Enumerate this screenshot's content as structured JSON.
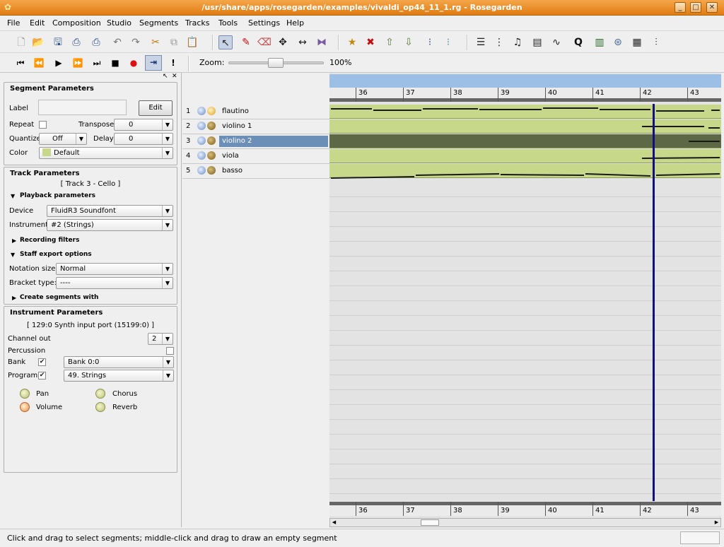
{
  "window": {
    "title": "/usr/share/apps/rosegarden/examples/vivaldi_op44_11_1.rg - Rosegarden"
  },
  "menu": [
    "File",
    "Edit",
    "Composition",
    "Studio",
    "Segments",
    "Tracks",
    "Tools",
    "Settings",
    "Help"
  ],
  "zoom": {
    "label": "Zoom:",
    "value": "100%",
    "level_percent": 100
  },
  "segment_params": {
    "title": "Segment Parameters",
    "label_label": "Label",
    "edit_button": "Edit",
    "repeat_label": "Repeat",
    "transpose_label": "Transpose",
    "transpose_value": "0",
    "quantize_label": "Quantize",
    "quantize_value": "Off",
    "delay_label": "Delay",
    "delay_value": "0",
    "color_label": "Color",
    "color_value": "Default"
  },
  "track_params": {
    "title": "Track Parameters",
    "track_info": "[ Track 3 - Cello ]",
    "playback_header": "Playback parameters",
    "device_label": "Device",
    "device_value": "FluidR3 Soundfont",
    "instrument_label": "Instrument",
    "instrument_value": "#2 (Strings)",
    "recording_header": "Recording filters",
    "staff_header": "Staff export options",
    "notation_label": "Notation size:",
    "notation_value": "Normal",
    "bracket_label": "Bracket type:",
    "bracket_value": "----",
    "create_header": "Create segments with"
  },
  "instrument_params": {
    "title": "Instrument Parameters",
    "port_info": "[ 129:0 Synth input port (15199:0) ]",
    "channel_label": "Channel out",
    "channel_value": "2",
    "percussion_label": "Percussion",
    "bank_label": "Bank",
    "bank_value": "Bank 0:0",
    "program_label": "Program",
    "program_value": "49. Strings",
    "pan_label": "Pan",
    "chorus_label": "Chorus",
    "volume_label": "Volume",
    "reverb_label": "Reverb"
  },
  "tracks": [
    {
      "num": "1",
      "name": "flautino"
    },
    {
      "num": "2",
      "name": "violino 1"
    },
    {
      "num": "3",
      "name": "violino 2"
    },
    {
      "num": "4",
      "name": "viola"
    },
    {
      "num": "5",
      "name": "basso"
    }
  ],
  "ruler": {
    "bars": [
      "36",
      "37",
      "38",
      "39",
      "40",
      "41",
      "42",
      "43"
    ]
  },
  "status": {
    "message": "Click and drag to select segments; middle-click and drag to draw an empty segment"
  },
  "colors": {
    "title_bar": "#e88c22",
    "segment": "#c7d88a",
    "segment_selected": "#5d6846",
    "selection": "#6b8fb6",
    "cursor": "#101080"
  }
}
